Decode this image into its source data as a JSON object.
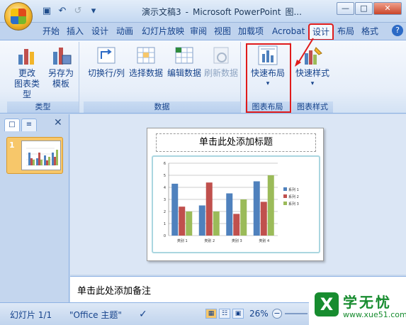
{
  "titlebar": {
    "document": "演示文稿3",
    "app": "Microsoft PowerPoint",
    "context": "图..."
  },
  "tabs": [
    "开始",
    "插入",
    "设计",
    "动画",
    "幻灯片放映",
    "审阅",
    "视图",
    "加载项",
    "Acrobat",
    "设计",
    "布局",
    "格式"
  ],
  "ribbon": {
    "groups": {
      "type": "类型",
      "data": "数据",
      "layout": "图表布局",
      "style": "图表样式"
    },
    "buttons": {
      "change_type": "更改\n图表类型",
      "save_template": "另存为\n模板",
      "switch": "切换行/列",
      "select": "选择数据",
      "edit": "编辑数据",
      "refresh": "刷新数据",
      "quick_layout": "快速布局",
      "quick_style": "快速样式"
    }
  },
  "leftpane": {
    "slide_number": "1"
  },
  "slide": {
    "title_placeholder": "单击此处添加标题"
  },
  "notes": {
    "placeholder": "单击此处添加备注"
  },
  "status": {
    "slide": "幻灯片 1/1",
    "theme": "\"Office 主题\"",
    "zoom": "26%"
  },
  "watermark": {
    "name": "学无忧",
    "url": "www.xue51.com",
    "logo": "X"
  },
  "chart_data": {
    "type": "bar",
    "categories": [
      "类别 1",
      "类别 2",
      "类别 3",
      "类别 4"
    ],
    "series": [
      {
        "name": "系列 1",
        "values": [
          4.3,
          2.5,
          3.5,
          4.5
        ],
        "color": "#4f81bd"
      },
      {
        "name": "系列 2",
        "values": [
          2.4,
          4.4,
          1.8,
          2.8
        ],
        "color": "#c0504d"
      },
      {
        "name": "系列 3",
        "values": [
          2,
          2,
          3,
          5
        ],
        "color": "#9bbb59"
      }
    ],
    "yticks": [
      "0",
      "1",
      "2",
      "3",
      "4",
      "5",
      "6"
    ],
    "ylim": [
      0,
      6
    ],
    "legend": "right"
  }
}
